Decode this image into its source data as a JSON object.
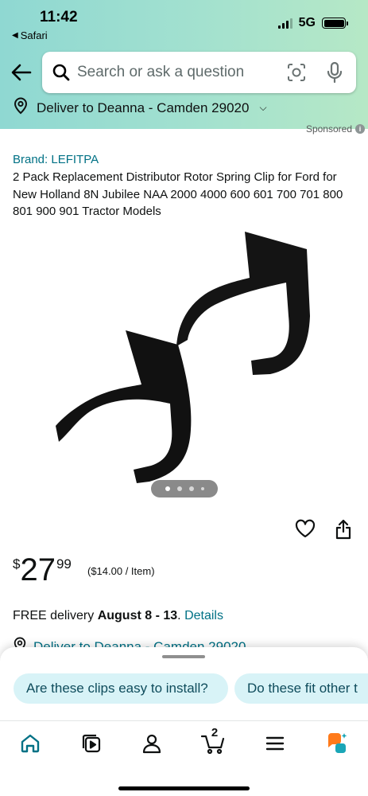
{
  "status_bar": {
    "time": "11:42",
    "back_app": "Safari",
    "network": "5G"
  },
  "search": {
    "placeholder": "Search or ask a question"
  },
  "deliver": {
    "label": "Deliver to Deanna - Camden 29020"
  },
  "sponsored": "Sponsored",
  "product": {
    "brand": "Brand: LEFITPA",
    "title": "2 Pack Replacement Distributor Rotor Spring Clip for Ford for New Holland 8N Jubilee NAA 2000 4000 600 601 700 701 800 801 900 901 Tractor Models",
    "image_count": 4,
    "active_image": 1,
    "price": {
      "symbol": "$",
      "whole": "27",
      "fraction": "99",
      "unit": "($14.00 / Item)"
    },
    "delivery": {
      "prefix": "FREE delivery ",
      "dates": "August 8 - 13",
      "separator": ". ",
      "link": "Details"
    },
    "deliver_repeat": "Deliver to Deanna - Camden 29020"
  },
  "suggestions": [
    "Are these clips easy to install?",
    "Do these fit other t"
  ],
  "tabbar": {
    "cart_count": "2",
    "items": [
      "home-icon",
      "video-icon",
      "account-icon",
      "cart-icon",
      "menu-icon",
      "rufus-icon"
    ]
  },
  "colors": {
    "link": "#007185",
    "header_gradient_start": "#8fd8d2",
    "header_gradient_end": "#b6e8c6",
    "chip_background": "#d8f3f7",
    "rufus_orange": "#ff7a1a",
    "rufus_teal": "#1aa6b7"
  }
}
